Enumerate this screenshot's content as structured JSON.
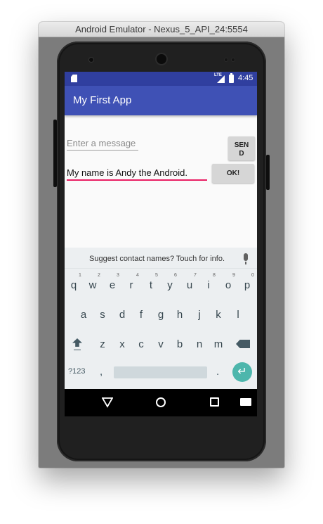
{
  "window": {
    "title": "Android Emulator - Nexus_5_API_24:5554"
  },
  "statusbar": {
    "time": "4:45",
    "network": "LTE"
  },
  "appbar": {
    "title": "My First App"
  },
  "form": {
    "message_placeholder": "Enter a message",
    "send_label": "SEND",
    "name_value": "My name is Andy the Android.",
    "ok_label": "OK!"
  },
  "keyboard": {
    "suggestion": "Suggest contact names? Touch for info.",
    "row1": [
      "q",
      "w",
      "e",
      "r",
      "t",
      "y",
      "u",
      "i",
      "o",
      "p"
    ],
    "row1_hints": [
      "1",
      "2",
      "3",
      "4",
      "5",
      "6",
      "7",
      "8",
      "9",
      "0"
    ],
    "row2": [
      "a",
      "s",
      "d",
      "f",
      "g",
      "h",
      "j",
      "k",
      "l"
    ],
    "row3": [
      "z",
      "x",
      "c",
      "v",
      "b",
      "n",
      "m"
    ],
    "symbols_label": "?123",
    "comma": ",",
    "period": ".",
    "enter_glyph": "↵"
  },
  "colors": {
    "status_bar": "#303f9f",
    "app_bar": "#3f51b5",
    "accent": "#e91e63",
    "enter_key": "#4db6ac"
  }
}
